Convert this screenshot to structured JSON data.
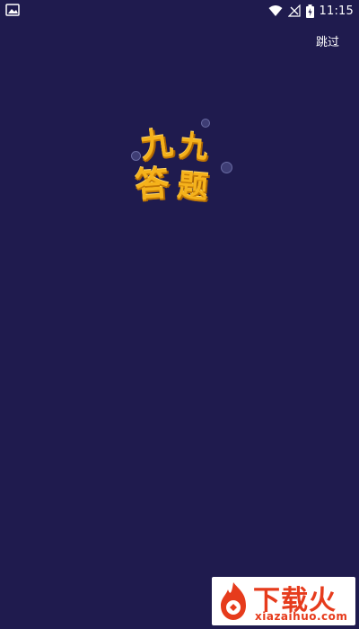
{
  "status_bar": {
    "time": "11:15",
    "icons": [
      "image-notification-icon",
      "wifi-icon",
      "signal-icon",
      "battery-charging-icon"
    ]
  },
  "header": {
    "skip_label": "跳过"
  },
  "logo": {
    "chars": [
      "九",
      "九",
      "答",
      "题"
    ],
    "text": "九九答题",
    "color": "#f5b21b"
  },
  "watermark": {
    "title": "下载火",
    "url": "xiazaihuo.com",
    "color": "#e63b1c"
  },
  "colors": {
    "background": "#1f1b4e"
  }
}
